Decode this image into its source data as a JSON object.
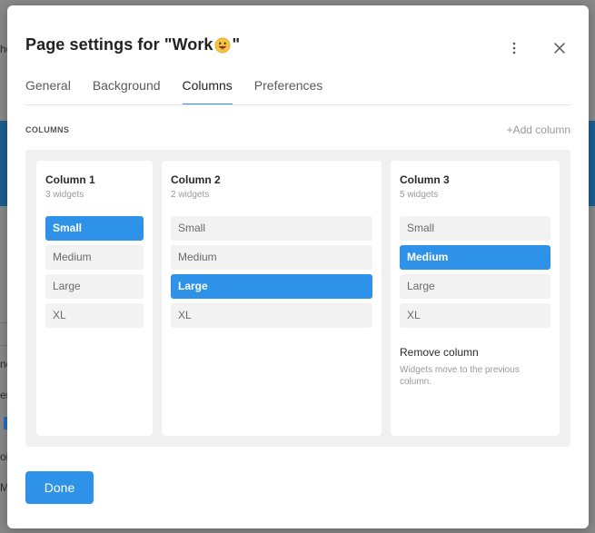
{
  "modal": {
    "title_prefix": "Page settings for \"Work",
    "title_suffix": "\"",
    "emoji_icon": "grinning-face-emoji"
  },
  "tabs": [
    {
      "label": "General",
      "active": false
    },
    {
      "label": "Background",
      "active": false
    },
    {
      "label": "Columns",
      "active": true
    },
    {
      "label": "Preferences",
      "active": false
    }
  ],
  "columns_section": {
    "label": "COLUMNS",
    "add_label": "+Add column"
  },
  "columns": [
    {
      "title": "Column 1",
      "subtitle": "3 widgets",
      "sizes": [
        "Small",
        "Medium",
        "Large",
        "XL"
      ],
      "selected": "Small"
    },
    {
      "title": "Column 2",
      "subtitle": "2 widgets",
      "sizes": [
        "Small",
        "Medium",
        "Large",
        "XL"
      ],
      "selected": "Large"
    },
    {
      "title": "Column 3",
      "subtitle": "5 widgets",
      "sizes": [
        "Small",
        "Medium",
        "Large",
        "XL"
      ],
      "selected": "Medium",
      "remove_label": "Remove column",
      "remove_desc": "Widgets move to the previous column."
    }
  ],
  "footer": {
    "done_label": "Done"
  },
  "colors": {
    "accent": "#2e93e8",
    "background_band": "#1b5d8f"
  },
  "background_app": {
    "fragments": [
      "ho",
      "ne",
      "er",
      "oi",
      "M"
    ]
  }
}
